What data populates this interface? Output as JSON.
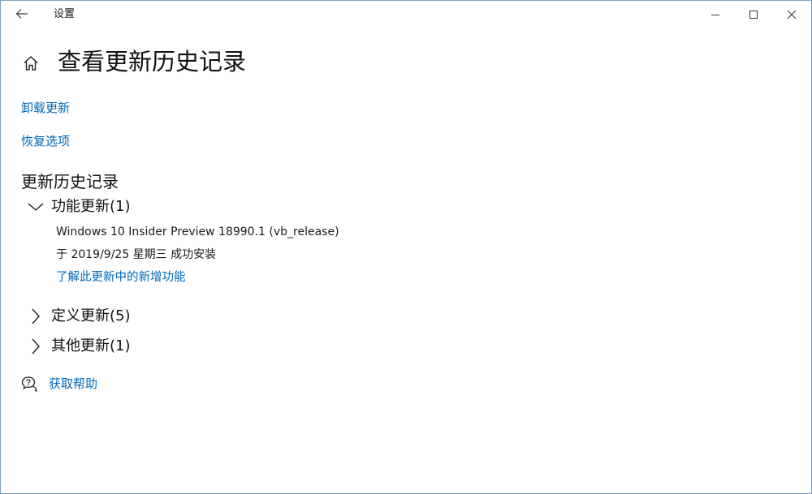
{
  "window": {
    "app_title": "设置",
    "border_color": "#7a9fc4"
  },
  "titlebar": {
    "back_icon": "arrow-left-icon",
    "minimize_icon": "minimize-icon",
    "maximize_icon": "maximize-icon",
    "close_icon": "close-icon"
  },
  "header": {
    "home_icon": "home-icon",
    "title": "查看更新历史记录"
  },
  "links": {
    "uninstall": "卸载更新",
    "recovery": "恢复选项"
  },
  "history": {
    "heading": "更新历史记录",
    "groups": [
      {
        "label": "功能更新(1)",
        "expanded": true,
        "entries": [
          {
            "name": "Windows 10 Insider Preview 18990.1 (vb_release)",
            "status": "于 2019/9/25 星期三 成功安装",
            "link": "了解此更新中的新增功能"
          }
        ]
      },
      {
        "label": "定义更新(5)",
        "expanded": false
      },
      {
        "label": "其他更新(1)",
        "expanded": false
      }
    ]
  },
  "help": {
    "icon": "help-chat-icon",
    "label": "获取帮助"
  },
  "colors": {
    "accent_link": "#0067b8",
    "text": "#1a1a1a",
    "background": "#ffffff"
  }
}
